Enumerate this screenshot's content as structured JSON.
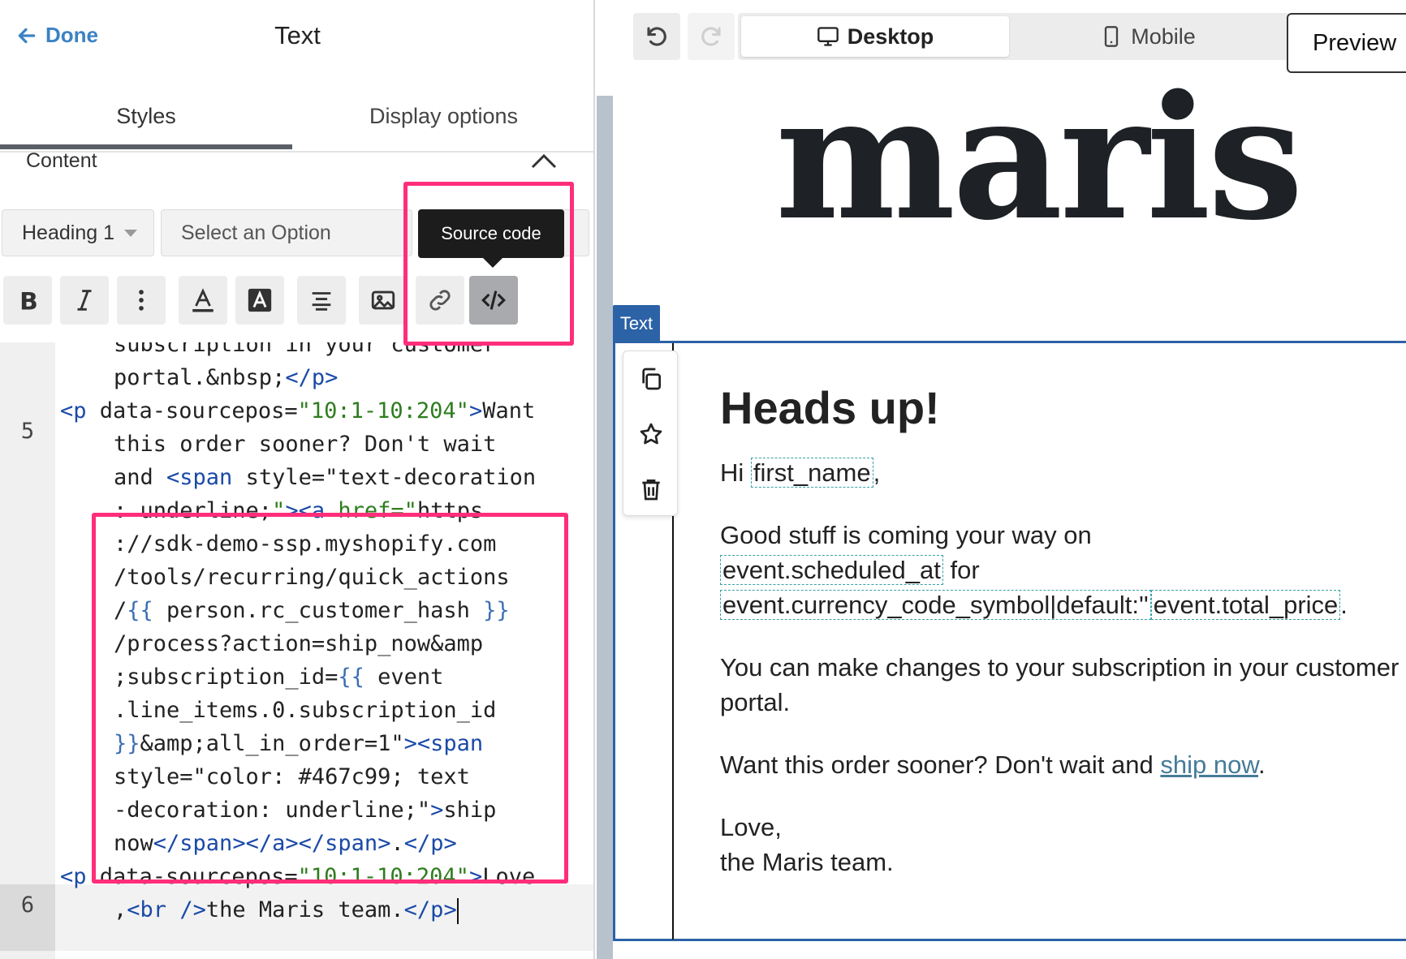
{
  "left_panel": {
    "done_label": "Done",
    "title": "Text",
    "tabs": [
      {
        "label": "Styles",
        "active": true
      },
      {
        "label": "Display options",
        "active": false
      }
    ],
    "section_label": "Content",
    "heading_select": "Heading 1",
    "option_select_placeholder": "Select an Option",
    "tooltip": "Source code",
    "toolbar_icons": [
      "bold-icon",
      "italic-icon",
      "more-vertical-icon",
      "text-color-icon",
      "highlight-icon",
      "align-center-icon",
      "image-icon",
      "link-icon",
      "code-icon"
    ],
    "code": {
      "line_numbers": [
        "5",
        "6"
      ],
      "lines": [
        "subscription in your customer",
        "portal.&nbsp;</p>",
        "<p data-sourcepos=\"10:1-10:204\">Want",
        "this order sooner? Don't wait",
        "and <span style=\"text-decoration",
        ": underline;\"><a href=\"https",
        "://sdk-demo-ssp.myshopify.com",
        "/tools/recurring/quick_actions",
        "/{{ person.rc_customer_hash }}",
        "/process?action=ship_now&amp",
        ";subscription_id={{ event",
        ".line_items.0.subscription_id",
        "}}&amp;all_in_order=1\"><span",
        "style=\"color: #467c99; text",
        "-decoration: underline;\">ship",
        "now</span></a></span>.</p>",
        "<p data-sourcepos=\"10:1-10:204\">Love",
        ",<br />the Maris team.</p>"
      ]
    },
    "highlight_color": "#ff2e7a"
  },
  "right_panel": {
    "device_tabs": [
      {
        "label": "Desktop",
        "icon": "monitor-icon",
        "active": true
      },
      {
        "label": "Mobile",
        "icon": "phone-icon",
        "active": false
      }
    ],
    "preview_label": "Preview",
    "brand_logo_text": "maris",
    "block_tag": "Text",
    "email": {
      "heading": "Heads up!",
      "greeting_prefix": "Hi ",
      "greeting_var": "first_name",
      "greeting_suffix": ",",
      "p2_text": "Good stuff is coming your way on",
      "p2_var1": "event.scheduled_at",
      "p2_for": " for",
      "p2_var2": "event.currency_code_symbol|default:''",
      "p2_var3": "event.total_price",
      "p2_end": ".",
      "p3": "You can make changes to your subscription in your customer portal.",
      "p4_prefix": "Want this order sooner? Don't wait and ",
      "p4_link": "ship now",
      "p4_suffix": ".",
      "sign_1": "Love,",
      "sign_2": "the Maris team."
    },
    "accent_color": "#2c62a6",
    "link_color": "#467c99"
  }
}
